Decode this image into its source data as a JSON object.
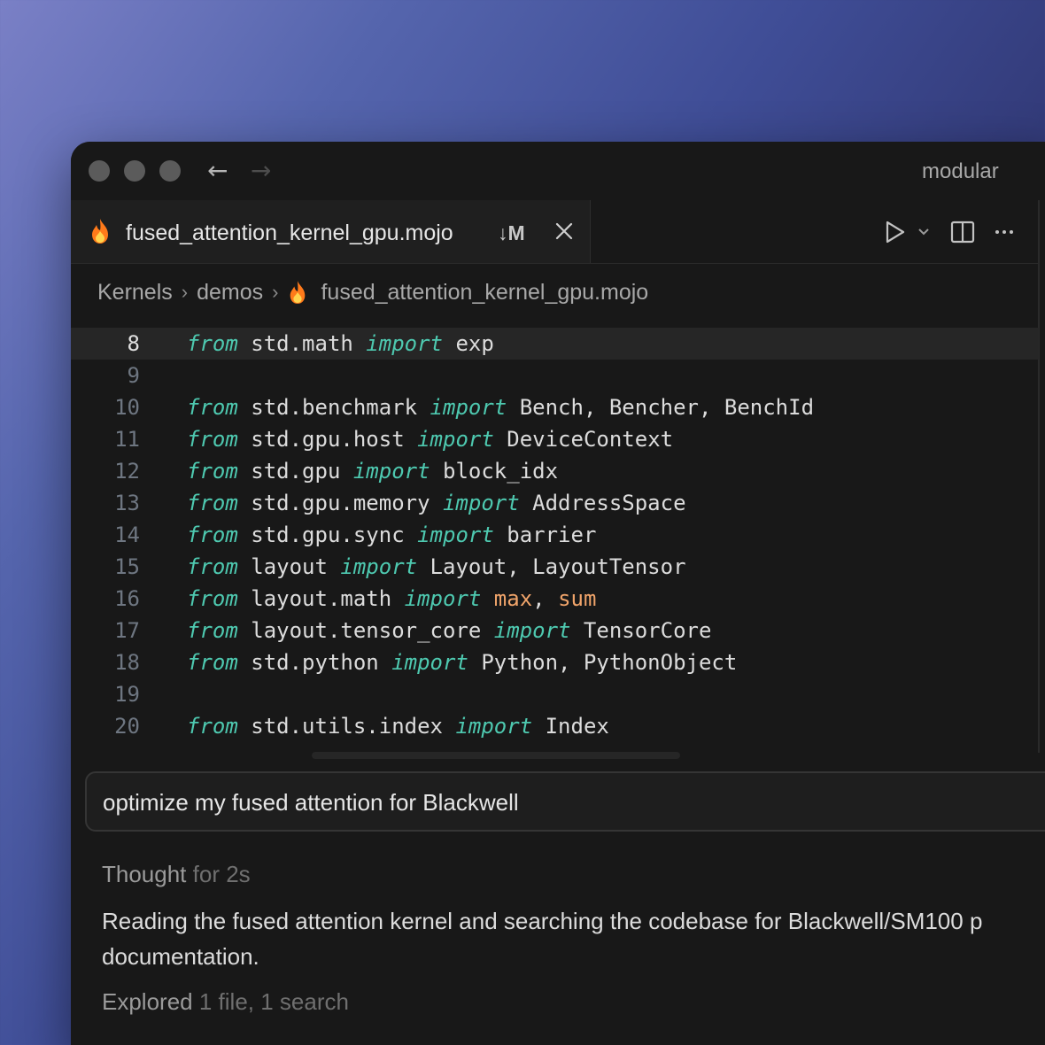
{
  "window": {
    "app_name": "modular"
  },
  "tab": {
    "filename": "fused_attention_kernel_gpu.mojo",
    "git_status": "↓M"
  },
  "breadcrumb": {
    "items": [
      "Kernels",
      "demos"
    ],
    "file": "fused_attention_kernel_gpu.mojo"
  },
  "editor": {
    "active_line": "8",
    "lines": [
      {
        "n": "8",
        "from": "from",
        "module": " std.math ",
        "import": "import",
        "names": " exp"
      },
      {
        "n": "9"
      },
      {
        "n": "10",
        "from": "from",
        "module": " std.benchmark ",
        "import": "import",
        "names": " Bench, Bencher, BenchId"
      },
      {
        "n": "11",
        "from": "from",
        "module": " std.gpu.host ",
        "import": "import",
        "names": " DeviceContext"
      },
      {
        "n": "12",
        "from": "from",
        "module": " std.gpu ",
        "import": "import",
        "names": " block_idx"
      },
      {
        "n": "13",
        "from": "from",
        "module": " std.gpu.memory ",
        "import": "import",
        "names": " AddressSpace"
      },
      {
        "n": "14",
        "from": "from",
        "module": " std.gpu.sync ",
        "import": "import",
        "names": " barrier"
      },
      {
        "n": "15",
        "from": "from",
        "module": " layout ",
        "import": "import",
        "names": " Layout, LayoutTensor"
      },
      {
        "n": "16",
        "from": "from",
        "module": " layout.math ",
        "import": "import",
        "names": " ",
        "fn1": "max",
        "sep": ", ",
        "fn2": "sum"
      },
      {
        "n": "17",
        "from": "from",
        "module": " layout.tensor_core ",
        "import": "import",
        "names": " TensorCore"
      },
      {
        "n": "18",
        "from": "from",
        "module": " std.python ",
        "import": "import",
        "names": " Python, PythonObject"
      },
      {
        "n": "19"
      },
      {
        "n": "20",
        "from": "from",
        "module": " std.utils.index ",
        "import": "import",
        "names": " Index"
      }
    ]
  },
  "chat": {
    "input_value": "optimize my fused attention for Blackwell",
    "thought_label": "Thought",
    "thought_duration": "for 2s",
    "reply_text": "Reading the fused attention kernel and searching the codebase for Blackwell/SM100 p documentation.",
    "explored_label": "Explored",
    "explored_detail": "1 file, 1 search"
  },
  "icons": {
    "traffic_lights": [
      "window-close-dot",
      "window-minimize-dot",
      "window-zoom-dot"
    ],
    "nav": [
      "back-arrow-icon",
      "forward-arrow-icon"
    ],
    "tab_file": "flame-icon",
    "tab_close": "close-icon",
    "toolbar": [
      "run-icon",
      "chevron-down-icon",
      "split-editor-icon",
      "more-icon"
    ]
  },
  "colors": {
    "keyword": "#4ec9b0",
    "function": "#f0a46a",
    "editor_bg": "#181818",
    "active_line_bg": "#262626"
  }
}
